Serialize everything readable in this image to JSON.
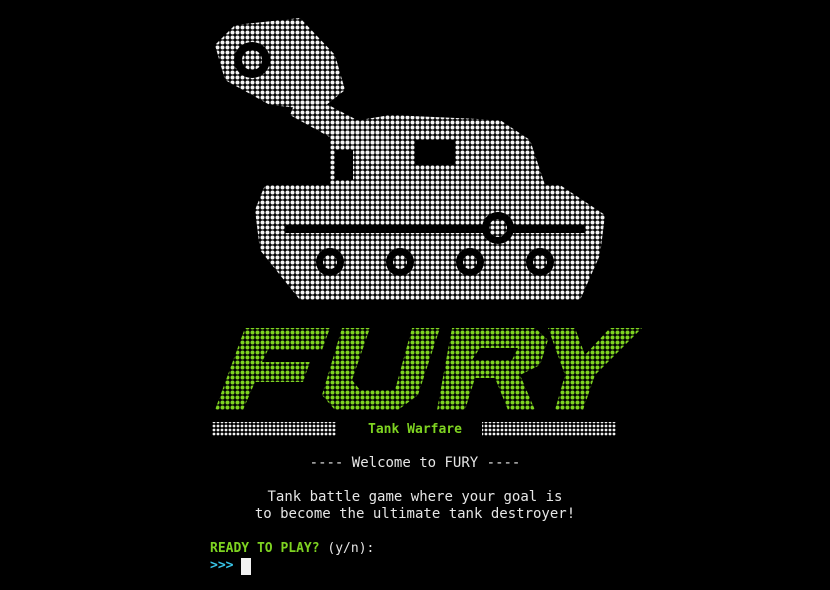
{
  "title": "FURY",
  "subtitle": "Tank Warfare",
  "welcome": "---- Welcome to FURY ----",
  "description": [
    "Tank battle game where your goal is",
    "to become the ultimate tank destroyer!"
  ],
  "prompt": {
    "label": "READY TO PLAY?",
    "options": "(y/n):",
    "chevron": ">>>"
  },
  "colors": {
    "background": "#000000",
    "tank": "#f2f2f2",
    "title": "#7ed321",
    "chevron": "#39c5e8"
  },
  "icons": {
    "tank_art": "tank-icon",
    "cursor": "block-cursor"
  }
}
